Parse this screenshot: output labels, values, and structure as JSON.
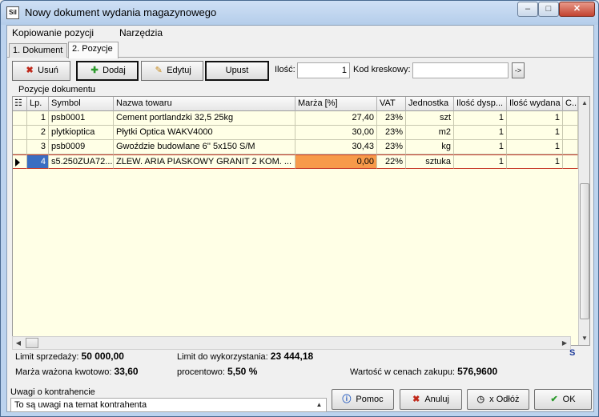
{
  "window": {
    "title": "Nowy dokument wydania magazynowego",
    "icon_text": "Sil"
  },
  "menu": [
    "Kopiowanie pozycji",
    "Narzędzia"
  ],
  "tabs": [
    "1. Dokument",
    "2. Pozycje"
  ],
  "toolbar": {
    "delete_label": "Usuń",
    "add_label": "Dodaj",
    "edit_label": "Edytuj",
    "discount_label": "Upust",
    "qty_label": "Ilość:",
    "qty_value": "1",
    "barcode_label": "Kod kreskowy:",
    "barcode_value": "",
    "barcode_go": "->"
  },
  "group_label": "Pozycje dokumentu",
  "grid": {
    "columns": [
      "Lp.",
      "Symbol",
      "Nazwa towaru",
      "Marża [%]",
      "VAT",
      "Jednostka",
      "Ilość dysp...",
      "Ilość wydana",
      "C..."
    ],
    "rows": [
      {
        "lp": "1",
        "symbol": "psb0001",
        "name": "Cement portlandzki 32,5 25kg",
        "margin": "27,40",
        "vat": "23%",
        "unit": "szt",
        "qty_avail": "1",
        "qty_issued": "1"
      },
      {
        "lp": "2",
        "symbol": "plytkioptica",
        "name": "Płytki Optica WAKV4000",
        "margin": "30,00",
        "vat": "23%",
        "unit": "m2",
        "qty_avail": "1",
        "qty_issued": "1"
      },
      {
        "lp": "3",
        "symbol": "psb0009",
        "name": "Gwoździe budowlane 6'' 5x150 S/M",
        "margin": "30,43",
        "vat": "23%",
        "unit": "kg",
        "qty_avail": "1",
        "qty_issued": "1"
      },
      {
        "lp": "4",
        "symbol": "s5.250ZUA72...",
        "name": "ZLEW. ARIA PIASKOWY GRANIT 2 KOM. ...",
        "margin": "0,00",
        "vat": "22%",
        "unit": "sztuka",
        "qty_avail": "1",
        "qty_issued": "1"
      }
    ],
    "scroll_marker": "S"
  },
  "summary": {
    "limit_label": "Limit sprzedaży:",
    "limit_value": "50 000,00",
    "limit_use_label": "Limit do wykorzystania:",
    "limit_use_value": "23 444,18",
    "margin_amount_label": "Marża ważona kwotowo:",
    "margin_amount_value": "33,60",
    "margin_pct_label": "procentowo:",
    "margin_pct_value": "5,50 %",
    "purchase_value_label": "Wartość w cenach zakupu:",
    "purchase_value": "576,9600"
  },
  "notes": {
    "label": "Uwagi o kontrahencie",
    "value": "To są uwagi na temat kontrahenta"
  },
  "buttons": {
    "help": "Pomoc",
    "cancel": "Anuluj",
    "postpone": "x Odłóż",
    "ok": "OK"
  }
}
